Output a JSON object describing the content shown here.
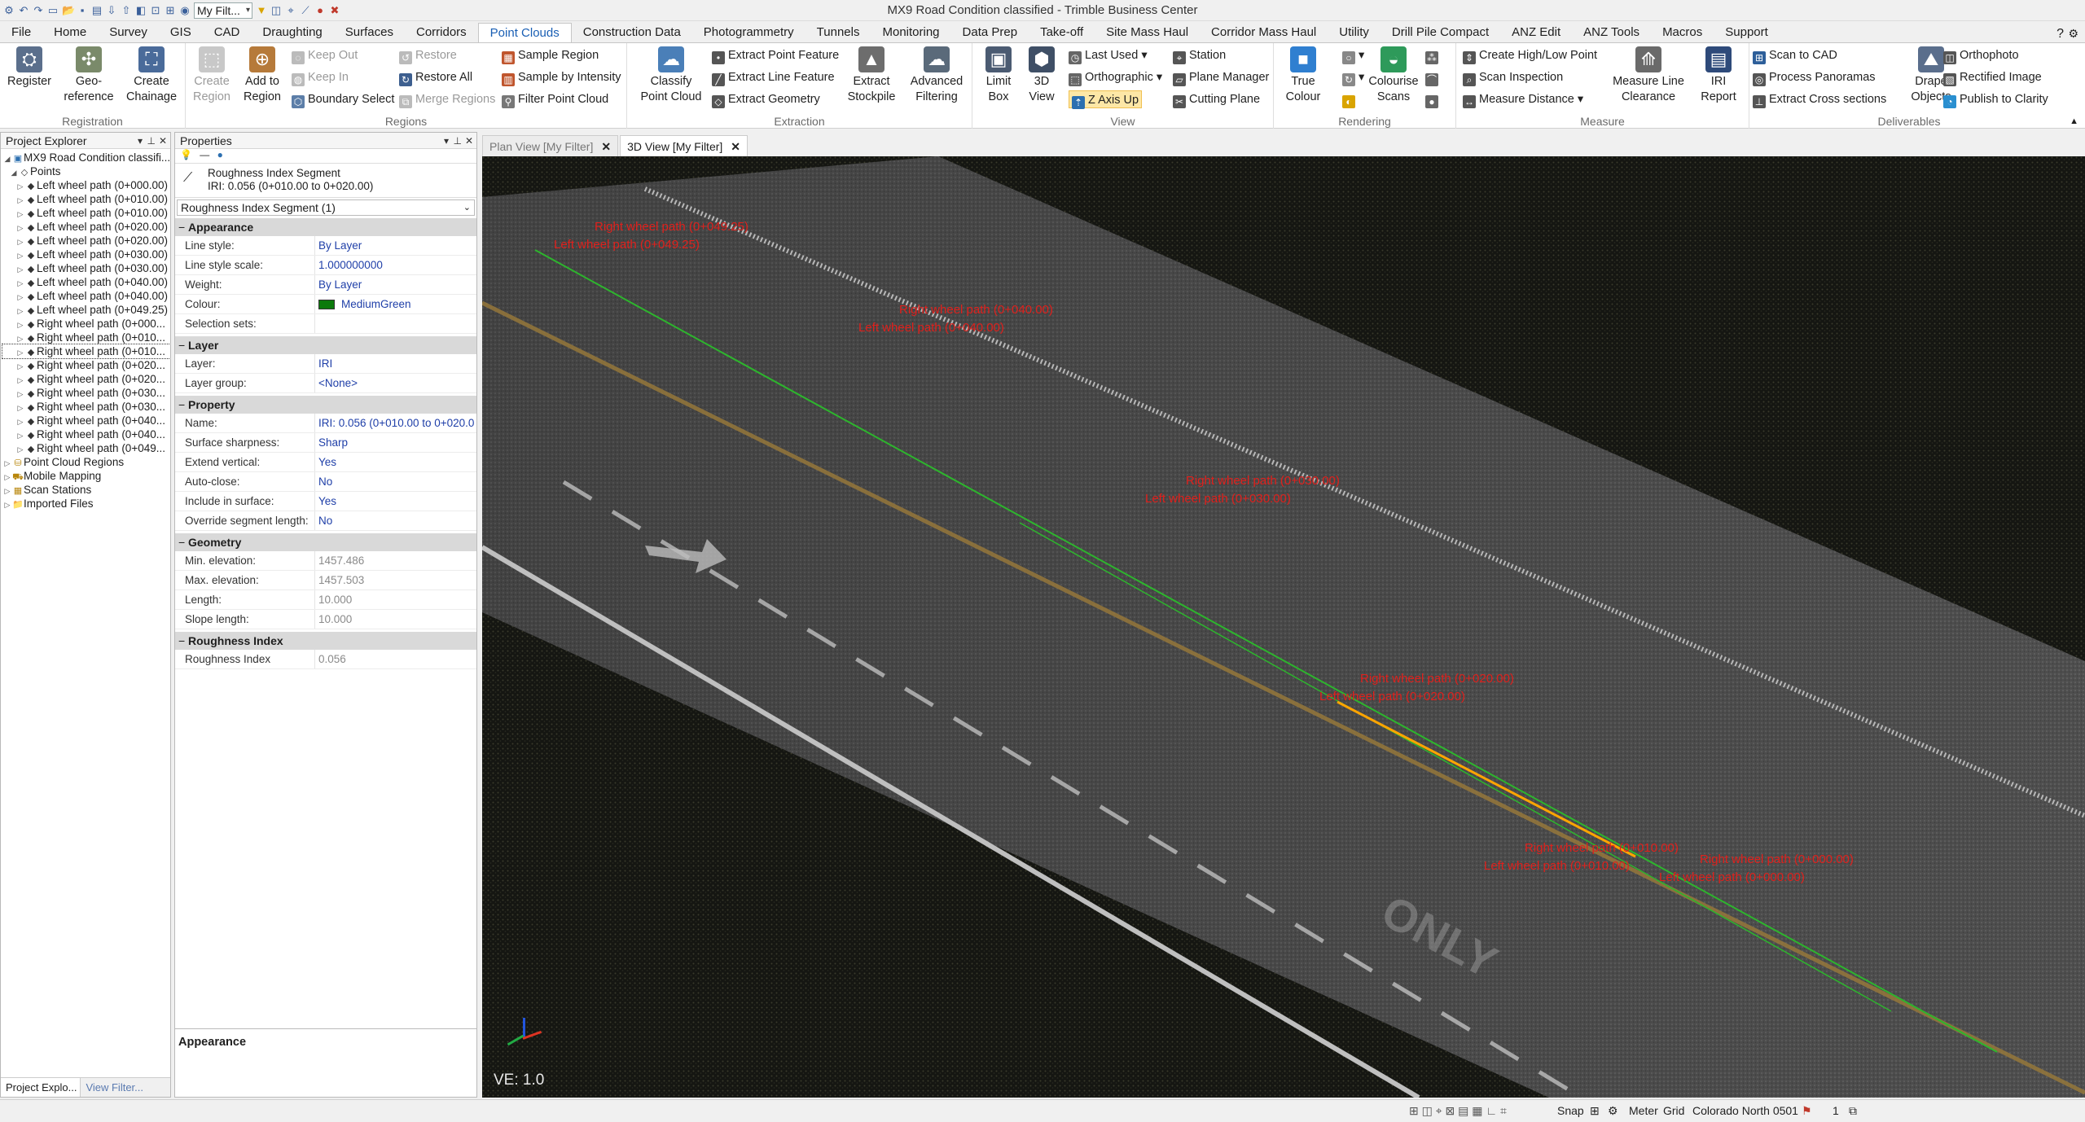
{
  "window": {
    "title": "MX9 Road Condition classified - Trimble Business Center",
    "filter_value": "My Filt..."
  },
  "menu": [
    "File",
    "Home",
    "Survey",
    "GIS",
    "CAD",
    "Draughting",
    "Surfaces",
    "Corridors",
    "Point Clouds",
    "Construction Data",
    "Photogrammetry",
    "Tunnels",
    "Monitoring",
    "Data Prep",
    "Take-off",
    "Site Mass Haul",
    "Corridor Mass Haul",
    "Utility",
    "Drill Pile Compact",
    "ANZ Edit",
    "ANZ Tools",
    "Macros",
    "Support"
  ],
  "ribbon": {
    "registration": {
      "title": "Registration",
      "register": "Register",
      "georeference": "Geo-\nreference",
      "create_chainage": "Create\nChainage"
    },
    "regions": {
      "title": "Regions",
      "create_region": "Create\nRegion",
      "add_to_region": "Add to\nRegion",
      "keep_out": "Keep Out",
      "keep_in": "Keep In",
      "boundary_select": "Boundary Select",
      "restore": "Restore",
      "restore_all": "Restore All",
      "merge_regions": "Merge Regions",
      "sample_region": "Sample Region",
      "sample_by_intensity": "Sample by Intensity",
      "filter_point_cloud": "Filter Point Cloud"
    },
    "extraction": {
      "title": "Extraction",
      "classify": "Classify\nPoint Cloud",
      "extract_point": "Extract Point Feature",
      "extract_line": "Extract Line Feature",
      "extract_geometry": "Extract Geometry",
      "extract_stockpile": "Extract\nStockpile",
      "advanced_filtering": "Advanced\nFiltering"
    },
    "view": {
      "title": "View",
      "limit_box": "Limit\nBox",
      "view_3d": "3D\nView",
      "last_used": "Last Used",
      "orthographic": "Orthographic",
      "z_axis_up": "Z Axis Up",
      "station": "Station",
      "plane_manager": "Plane Manager",
      "cutting_plane": "Cutting Plane"
    },
    "rendering": {
      "title": "Rendering",
      "true_colour": "True\nColour",
      "colourise_scans": "Colourise\nScans"
    },
    "measure": {
      "title": "Measure",
      "create_high_low": "Create High/Low Point",
      "scan_inspection": "Scan Inspection",
      "measure_distance": "Measure Distance",
      "measure_line_clearance": "Measure Line\nClearance",
      "iri_report": "IRI\nReport"
    },
    "deliverables": {
      "title": "Deliverables",
      "scan_to_cad": "Scan to CAD",
      "process_panoramas": "Process Panoramas",
      "extract_cross_sections": "Extract Cross sections",
      "drape_objects": "Drape\nObjects",
      "orthophoto": "Orthophoto",
      "rectified_image": "Rectified Image",
      "publish_to_clarity": "Publish to Clarity"
    }
  },
  "project_explorer": {
    "title": "Project Explorer",
    "root": "MX9 Road Condition classifi...",
    "points_label": "Points",
    "items": [
      "Left wheel path (0+000.00)",
      "Left wheel path (0+010.00)",
      "Left wheel path (0+010.00)",
      "Left wheel path (0+020.00)",
      "Left wheel path (0+020.00)",
      "Left wheel path (0+030.00)",
      "Left wheel path (0+030.00)",
      "Left wheel path (0+040.00)",
      "Left wheel path (0+040.00)",
      "Left wheel path (0+049.25)",
      "Right wheel path (0+000...",
      "Right wheel path (0+010...",
      "Right wheel path (0+010...",
      "Right wheel path (0+020...",
      "Right wheel path (0+020...",
      "Right wheel path (0+030...",
      "Right wheel path (0+030...",
      "Right wheel path (0+040...",
      "Right wheel path (0+040...",
      "Right wheel path (0+049..."
    ],
    "groups": [
      "Point Cloud Regions",
      "Mobile Mapping",
      "Scan Stations",
      "Imported Files"
    ]
  },
  "bottom_tabs": [
    "Project Explo...",
    "View Filter..."
  ],
  "properties": {
    "title": "Properties",
    "object_type": "Roughness Index Segment",
    "object_desc": "IRI: 0.056 (0+010.00 to 0+020.00)",
    "combo": "Roughness Index Segment (1)",
    "sections": [
      {
        "name": "Appearance",
        "rows": [
          [
            "Line style:",
            "By Layer"
          ],
          [
            "Line style scale:",
            "1.000000000"
          ],
          [
            "Weight:",
            "By Layer"
          ],
          [
            "Colour:",
            "MediumGreen"
          ],
          [
            "Selection sets:",
            ""
          ]
        ]
      },
      {
        "name": "Layer",
        "rows": [
          [
            "Layer:",
            "IRI"
          ],
          [
            "Layer group:",
            "<None>"
          ]
        ]
      },
      {
        "name": "Property",
        "rows": [
          [
            "Name:",
            "IRI: 0.056 (0+010.00 to 0+020.0"
          ],
          [
            "Surface sharpness:",
            "Sharp"
          ],
          [
            "Extend vertical:",
            "Yes"
          ],
          [
            "Auto-close:",
            "No"
          ],
          [
            "Include in surface:",
            "Yes"
          ],
          [
            "Override segment length:",
            "No"
          ]
        ]
      },
      {
        "name": "Geometry",
        "rows": [
          [
            "Min. elevation:",
            "1457.486"
          ],
          [
            "Max. elevation:",
            "1457.503"
          ],
          [
            "Length:",
            "10.000"
          ],
          [
            "Slope length:",
            "10.000"
          ]
        ]
      },
      {
        "name": "Roughness Index",
        "rows": [
          [
            "Roughness Index",
            "0.056"
          ]
        ]
      }
    ],
    "footer": "Appearance"
  },
  "view_tabs": [
    "Plan View [My Filter]",
    "3D View [My Filter]"
  ],
  "viewport": {
    "ve_label": "VE: 1.0",
    "labels": [
      {
        "a": "Right wheel path (0+049.25)",
        "b": "Left wheel path (0+049.25)"
      },
      {
        "a": "Right wheel path (0+040.00)",
        "b": "Left wheel path (0+040.00)"
      },
      {
        "a": "Right wheel path (0+030.00)",
        "b": "Left wheel path (0+030.00)"
      },
      {
        "a": "Right wheel path (0+020.00)",
        "b": "Left wheel path (0+020.00)"
      },
      {
        "a": "Right wheel path (0+010.00)",
        "b": "Left wheel path (0+010.00)"
      },
      {
        "a": "Right wheel path (0+000.00)",
        "b": "Left wheel path (0+000.00)"
      }
    ]
  },
  "status": {
    "snap": "Snap",
    "unit": "Meter",
    "grid": "Grid",
    "crs": "Colorado North 0501",
    "count": "1"
  }
}
